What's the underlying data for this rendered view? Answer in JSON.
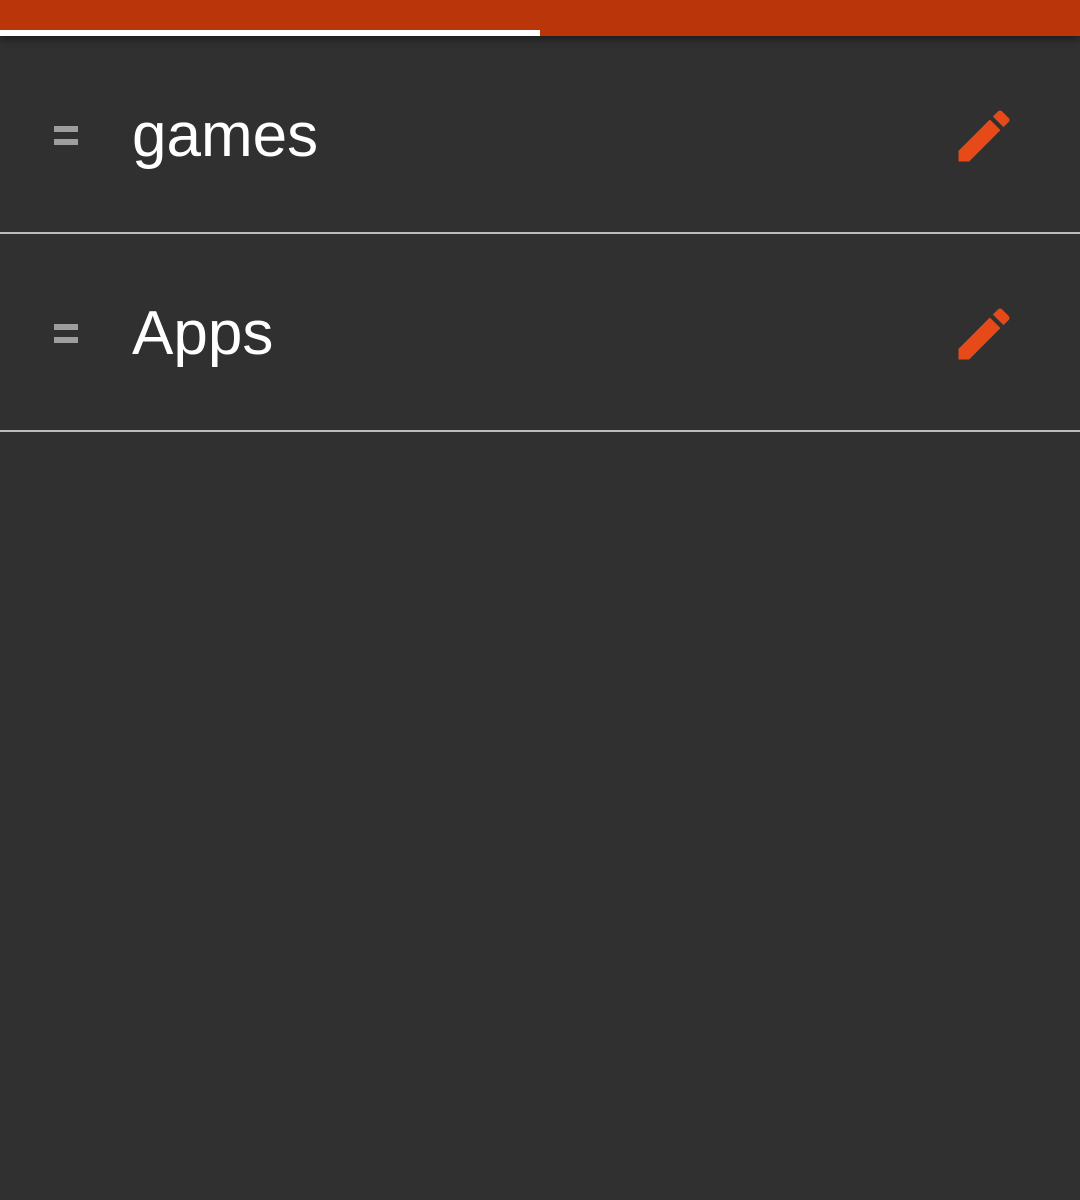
{
  "theme": {
    "accent": "#bb350b",
    "icon_accent": "#e64a19",
    "background": "#303030",
    "divider": "#bdbdbd",
    "text": "#ffffff"
  },
  "tabs": {
    "selected_index": 0,
    "count": 2
  },
  "list": {
    "items": [
      {
        "label": "games",
        "handle_icon": "drag-handle-icon",
        "action_icon": "pencil-icon"
      },
      {
        "label": "Apps",
        "handle_icon": "drag-handle-icon",
        "action_icon": "pencil-icon"
      }
    ]
  }
}
